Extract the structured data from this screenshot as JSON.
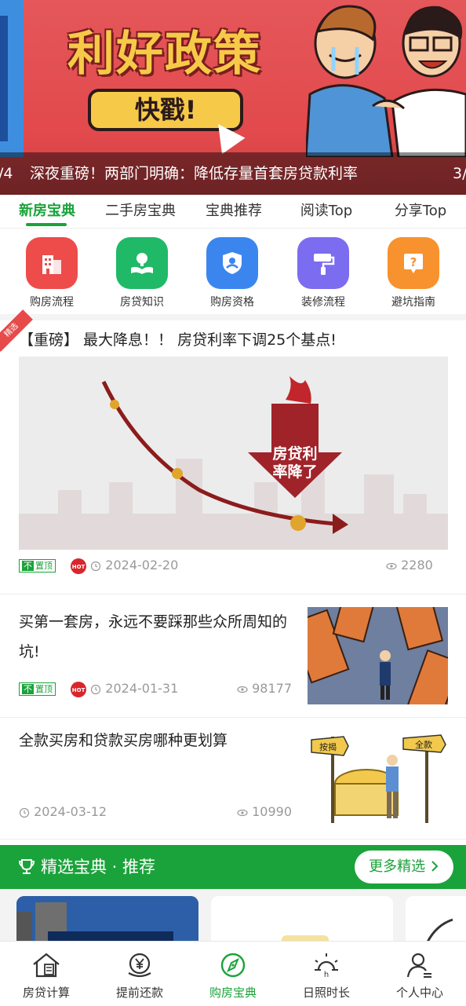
{
  "banner": {
    "headline": "利好政策",
    "button_label": "快戳!",
    "caption": "深夜重磅！两部门明确：降低存量首套房贷款利率",
    "index_left": "/4",
    "index_right": "3/"
  },
  "tabs": [
    "新房宝典",
    "二手房宝典",
    "宝典推荐",
    "阅读Top",
    "分享Top"
  ],
  "active_tab": "新房宝典",
  "quick_links": [
    {
      "label": "购房流程",
      "icon": "building-icon",
      "color": "#ee4b4b"
    },
    {
      "label": "房贷知识",
      "icon": "book-bulb-icon",
      "color": "#20b968"
    },
    {
      "label": "购房资格",
      "icon": "shield-user-icon",
      "color": "#3b86ee"
    },
    {
      "label": "装修流程",
      "icon": "paint-roller-icon",
      "color": "#7b6cf0"
    },
    {
      "label": "避坑指南",
      "icon": "question-icon",
      "color": "#f7922e"
    }
  ],
  "featured_article": {
    "ribbon": "精选",
    "title": "【重磅】 最大降息！！ 房贷利率下调25个基点!",
    "image_text": [
      "房贷利",
      "率降了"
    ],
    "tag": "置顶",
    "hot": "HOT",
    "date": "2024-02-20",
    "views": "2280"
  },
  "articles": [
    {
      "title": "买第一套房，永远不要踩那些众所周知的坑!",
      "tag": "置顶",
      "hot": "HOT",
      "date": "2024-01-31",
      "views": "98177"
    },
    {
      "title": "全款买房和贷款买房哪种更划算",
      "date": "2024-03-12",
      "views": "10990",
      "thumb_labels": [
        "按揭",
        "全款"
      ]
    }
  ],
  "featured_section": {
    "title": "精选宝典 · 推荐",
    "more_label": "更多精选"
  },
  "bottom_nav": [
    {
      "label": "房贷计算",
      "icon": "house-calculator-icon"
    },
    {
      "label": "提前还款",
      "icon": "yen-coin-icon"
    },
    {
      "label": "购房宝典",
      "icon": "compass-icon"
    },
    {
      "label": "日照时长",
      "icon": "sun-icon"
    },
    {
      "label": "个人中心",
      "icon": "user-icon"
    }
  ],
  "accent_color": "#1aa33a"
}
